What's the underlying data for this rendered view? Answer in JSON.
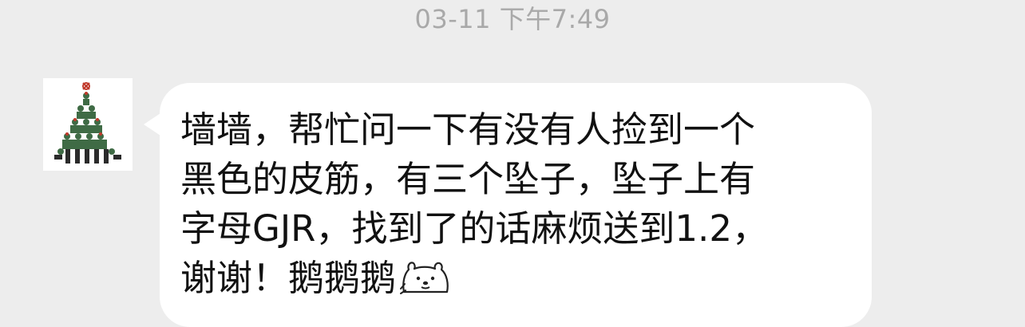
{
  "chat": {
    "timestamp": "03-11 下午7:49",
    "message": {
      "lines": [
        "墙墙，帮忙问一下有没有人捡到一个",
        "黑色的皮筋，有三个坠子，坠子上有",
        "字母GJR，找到了的话麻烦送到1.2，",
        "谢谢！鹅鹅鹅"
      ],
      "emoji": "bear-face-emoji"
    },
    "avatar": {
      "icon": "christmas-tree-group-photo"
    }
  },
  "colors": {
    "background": "#ededed",
    "bubble": "#ffffff",
    "timestamp_text": "#a9a9a9",
    "message_text": "#111111"
  }
}
